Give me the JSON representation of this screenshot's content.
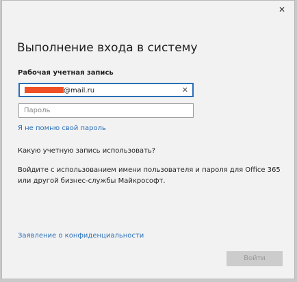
{
  "window": {
    "close_glyph": "✕"
  },
  "heading": "Выполнение входа в систему",
  "account": {
    "label": "Рабочая учетная запись",
    "email_suffix": "@mail.ru",
    "password_placeholder": "Пароль"
  },
  "links": {
    "forgot_password": "Я не помню свой пароль",
    "privacy": "Заявление о конфиденциальности"
  },
  "which_account": {
    "title": "Какую учетную запись использовать?",
    "description": "Войдите с использованием имени пользователя и пароля для Office 365 или другой бизнес-службы Майкрософт."
  },
  "buttons": {
    "signin": "Войти",
    "clear_glyph": "✕"
  },
  "colors": {
    "accent": "#2a6fb8",
    "redaction": "#f05028"
  }
}
